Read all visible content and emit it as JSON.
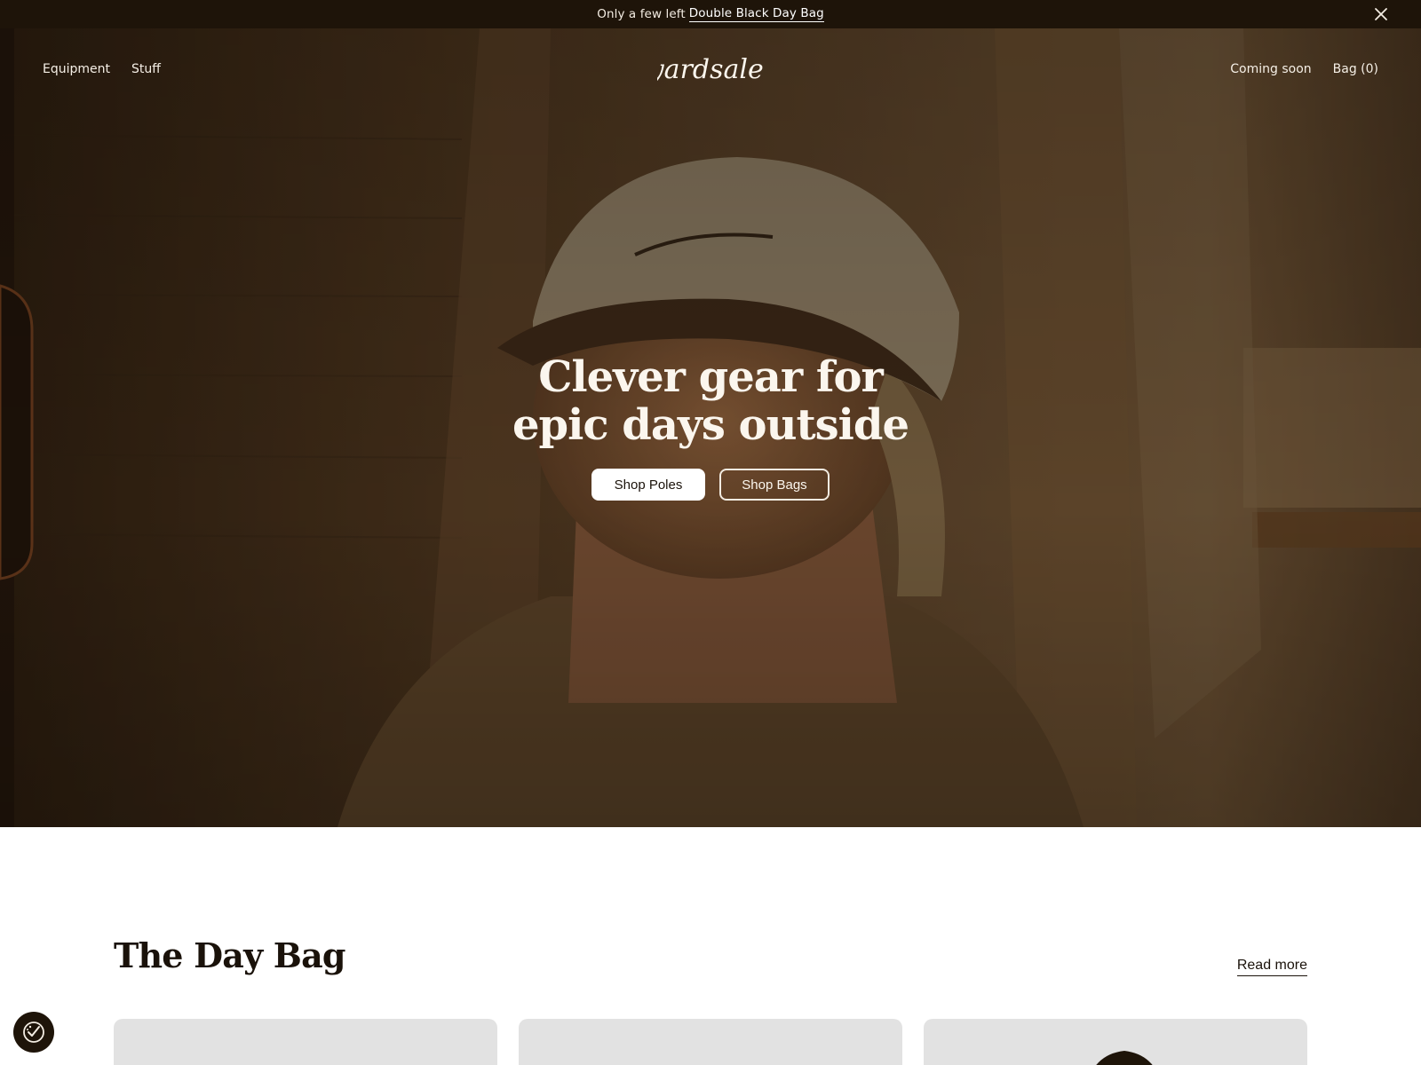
{
  "announcement": {
    "text": "Only a few left",
    "link_label": "Double Black Day Bag",
    "close_icon": "close-icon"
  },
  "nav": {
    "left": [
      {
        "label": "Equipment"
      },
      {
        "label": "Stuff"
      }
    ],
    "logo_text": "yardsale.",
    "right": [
      {
        "label": "Coming soon"
      },
      {
        "label": "Bag (0)"
      }
    ]
  },
  "hero": {
    "title_line1": "Clever gear for",
    "title_line2": "epic days outside",
    "primary_button": "Shop Poles",
    "secondary_button": "Shop Bags"
  },
  "section": {
    "title": "The Day Bag",
    "read_more": "Read more"
  },
  "cookie": {
    "icon": "cookie-consent-icon"
  },
  "colors": {
    "announcement_bg": "#1e1409",
    "hero_overlay": "#3a2a18",
    "text_dark": "#1a120a",
    "card_bg": "#e2e2e2"
  }
}
